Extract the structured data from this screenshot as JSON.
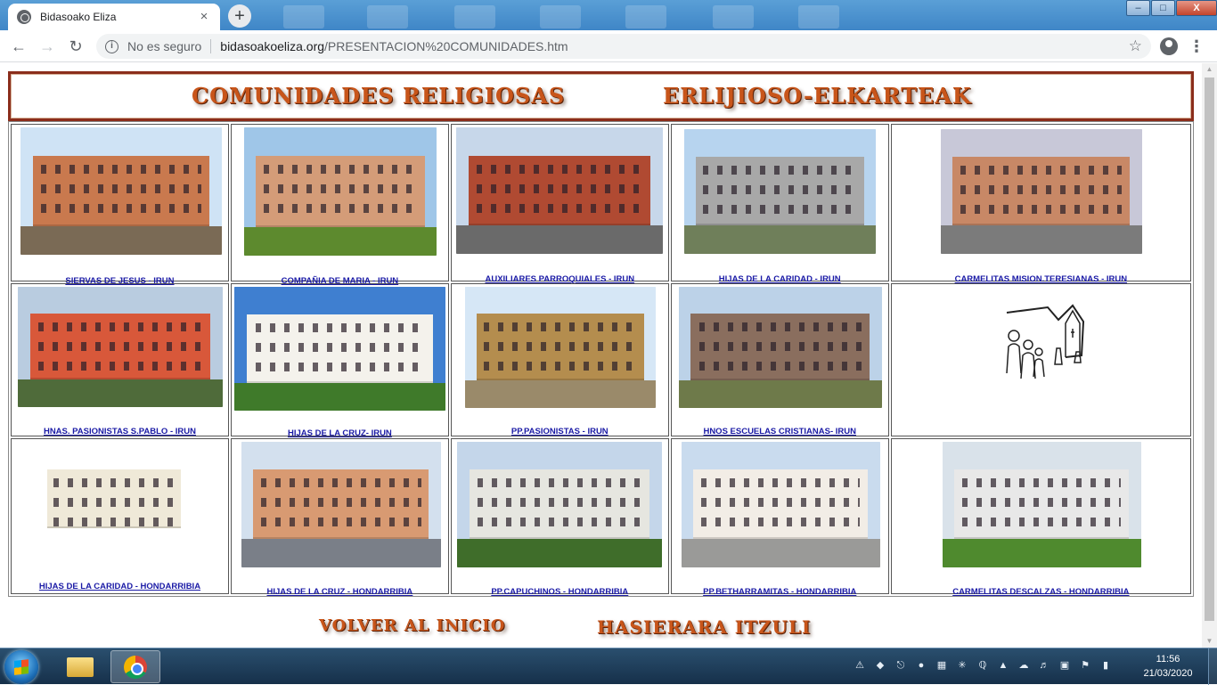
{
  "browser": {
    "tab_title": "Bidasoako Eliza",
    "tab_close": "×",
    "new_tab": "+",
    "security_label": "No es seguro",
    "url_domain": "bidasoakoeliza.org",
    "url_path": "/PRESENTACION%20COMUNIDADES.htm",
    "window_minimize": "–",
    "window_maximize": "□",
    "window_close": "X"
  },
  "page": {
    "header_left": "COMUNIDADES RELIGIOSAS",
    "header_right": "ERLIJIOSO-ELKARTEAK",
    "rows": [
      [
        {
          "label": "SIERVAS DE JESUS - IRUN",
          "photo": "building-photo",
          "sky": "#cfe3f5",
          "bldg": "#c9794e",
          "grass": "#7a6a55"
        },
        {
          "label": "COMPAÑIA DE MARIA - IRUN",
          "photo": "building-photo",
          "sky": "#9fc6e8",
          "bldg": "#d49c78",
          "grass": "#5d8a2e"
        },
        {
          "label": "AUXILIARES PARROQUIALES - IRUN",
          "photo": "building-photo",
          "sky": "#c7d7ea",
          "bldg": "#b04a32",
          "grass": "#6a6a6a"
        },
        {
          "label": "HIJAS DE LA CARIDAD - IRUN",
          "photo": "building-photo",
          "sky": "#b7d4ef",
          "bldg": "#a8a8a8",
          "grass": "#6f7f5a"
        },
        {
          "label": "CARMELITAS MISION.TERESIANAS - IRUN",
          "photo": "building-photo",
          "sky": "#c8c8d8",
          "bldg": "#c88866",
          "grass": "#7b7b7b"
        }
      ],
      [
        {
          "label": "HNAS. PASIONISTAS S.PABLO - IRUN",
          "photo": "building-photo",
          "sky": "#b9cce0",
          "bldg": "#d8583a",
          "grass": "#4f6b3a"
        },
        {
          "label": "HIJAS DE LA CRUZ- IRUN",
          "photo": "building-photo",
          "sky": "#3f7fd0",
          "bldg": "#f4f2ec",
          "grass": "#3f7a2a"
        },
        {
          "label": "PP.PASIONISTAS - IRUN",
          "photo": "building-photo",
          "sky": "#d6e7f6",
          "bldg": "#b48d4e",
          "grass": "#9a8a6a"
        },
        {
          "label": "HNOS ESCUELAS CRISTIANAS-  IRUN",
          "photo": "building-photo",
          "sky": "#bcd2e8",
          "bldg": "#8a6e5e",
          "grass": "#6e7a4a"
        },
        {
          "label": "",
          "photo": "community-logo"
        }
      ],
      [
        {
          "label": "HIJAS DE LA CARIDAD - HONDARRIBIA",
          "photo": "house-cutout",
          "sky": "#ffffff",
          "bldg": "#efe9d8",
          "grass": "#ffffff"
        },
        {
          "label": "HIJAS DE LA CRUZ - HONDARRIBIA",
          "photo": "building-photo",
          "sky": "#d3e0ee",
          "bldg": "#d89a72",
          "grass": "#7a7f88"
        },
        {
          "label": "PP.CAPUCHINOS - HONDARRIBIA",
          "photo": "building-photo",
          "sky": "#c4d6ea",
          "bldg": "#e6e6e0",
          "grass": "#3f6d2a"
        },
        {
          "label": "PP.BETHARRAMITAS - HONDARRIBIA",
          "photo": "building-photo",
          "sky": "#c9dbee",
          "bldg": "#f2ede6",
          "grass": "#9a9a98"
        },
        {
          "label": "CARMELITAS DESCALZAS  - HONDARRIBIA",
          "photo": "building-photo",
          "sky": "#d9e2ea",
          "bldg": "#e8e8e8",
          "grass": "#4f8a2e"
        }
      ]
    ],
    "footer_left": "VOLVER AL INICIO",
    "footer_right": "HASIERARA ITZULI"
  },
  "taskbar": {
    "time": "11:56",
    "date": "21/03/2020"
  }
}
